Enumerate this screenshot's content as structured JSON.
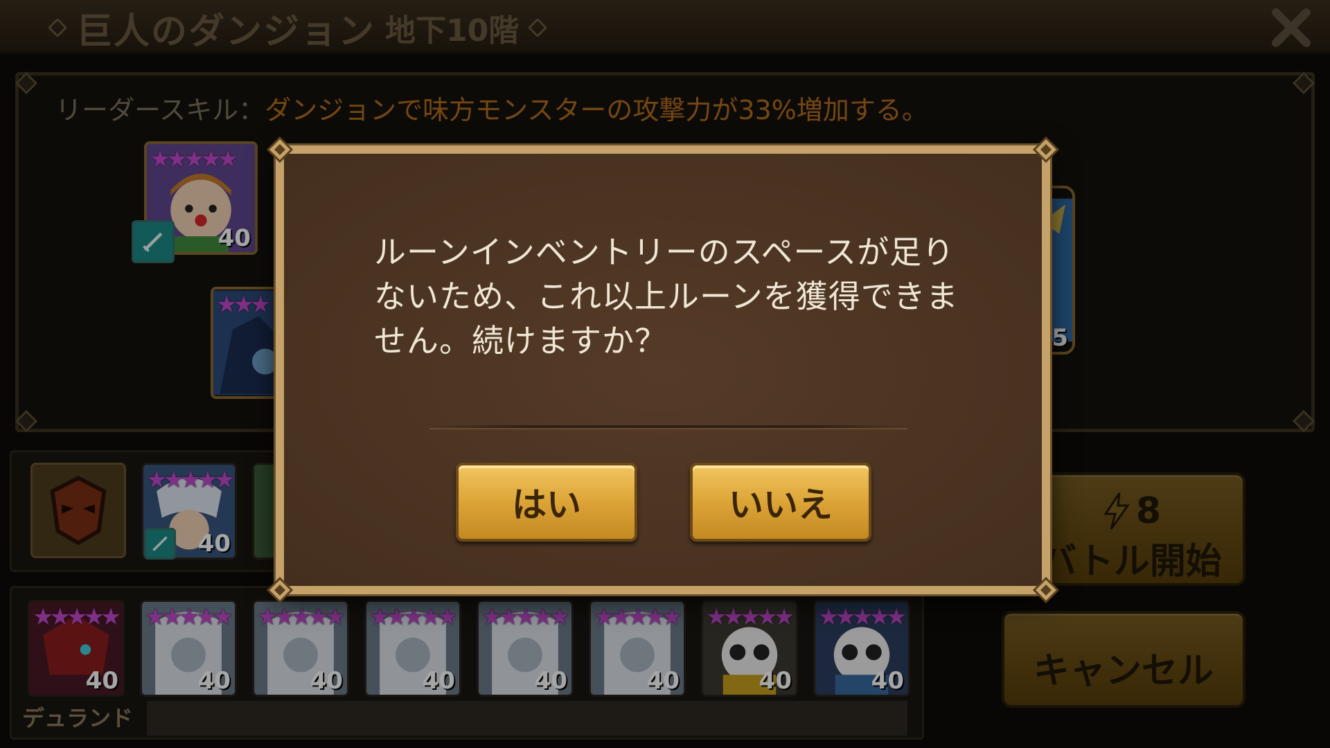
{
  "header": {
    "title_main": "巨人のダンジョン",
    "title_floor": "地下10階",
    "close_icon": "close-x-icon"
  },
  "leader": {
    "label": "リーダースキル：",
    "skill_text": "ダンジョンで味方モンスターの攻撃力が33%増加する。"
  },
  "team": {
    "monsters": [
      {
        "stars": "★★★★★",
        "level": "40"
      },
      {
        "stars": "★★★",
        "level": ""
      },
      {
        "stars": "",
        "level": "5"
      }
    ]
  },
  "lower_row": {
    "monsters": [
      {
        "stars": "★★★★★",
        "level": "40"
      },
      {
        "stars": "",
        "level": ""
      }
    ]
  },
  "roster": {
    "label": "デュランド",
    "monsters": [
      {
        "stars": "★★★★★",
        "level": "40"
      },
      {
        "stars": "★★★★★",
        "level": "40"
      },
      {
        "stars": "★★★★★",
        "level": "40"
      },
      {
        "stars": "★★★★★",
        "level": "40"
      },
      {
        "stars": "★★★★★",
        "level": "40"
      },
      {
        "stars": "★★★★★",
        "level": "40"
      },
      {
        "stars": "★★★★★",
        "level": "40"
      },
      {
        "stars": "★★★★★",
        "level": "40"
      }
    ]
  },
  "buttons": {
    "energy_cost": "8",
    "start_label": "バトル開始",
    "cancel_label": "キャンセル"
  },
  "dialog": {
    "message": "ルーンインベントリーのスペースが足りないため、これ以上ルーンを獲得できません。続けますか？",
    "yes_label": "はい",
    "no_label": "いいえ"
  },
  "colors": {
    "skill_text": "#b46e1d",
    "dialog_bg": "#4b3422",
    "button_gold": "#dca437"
  }
}
